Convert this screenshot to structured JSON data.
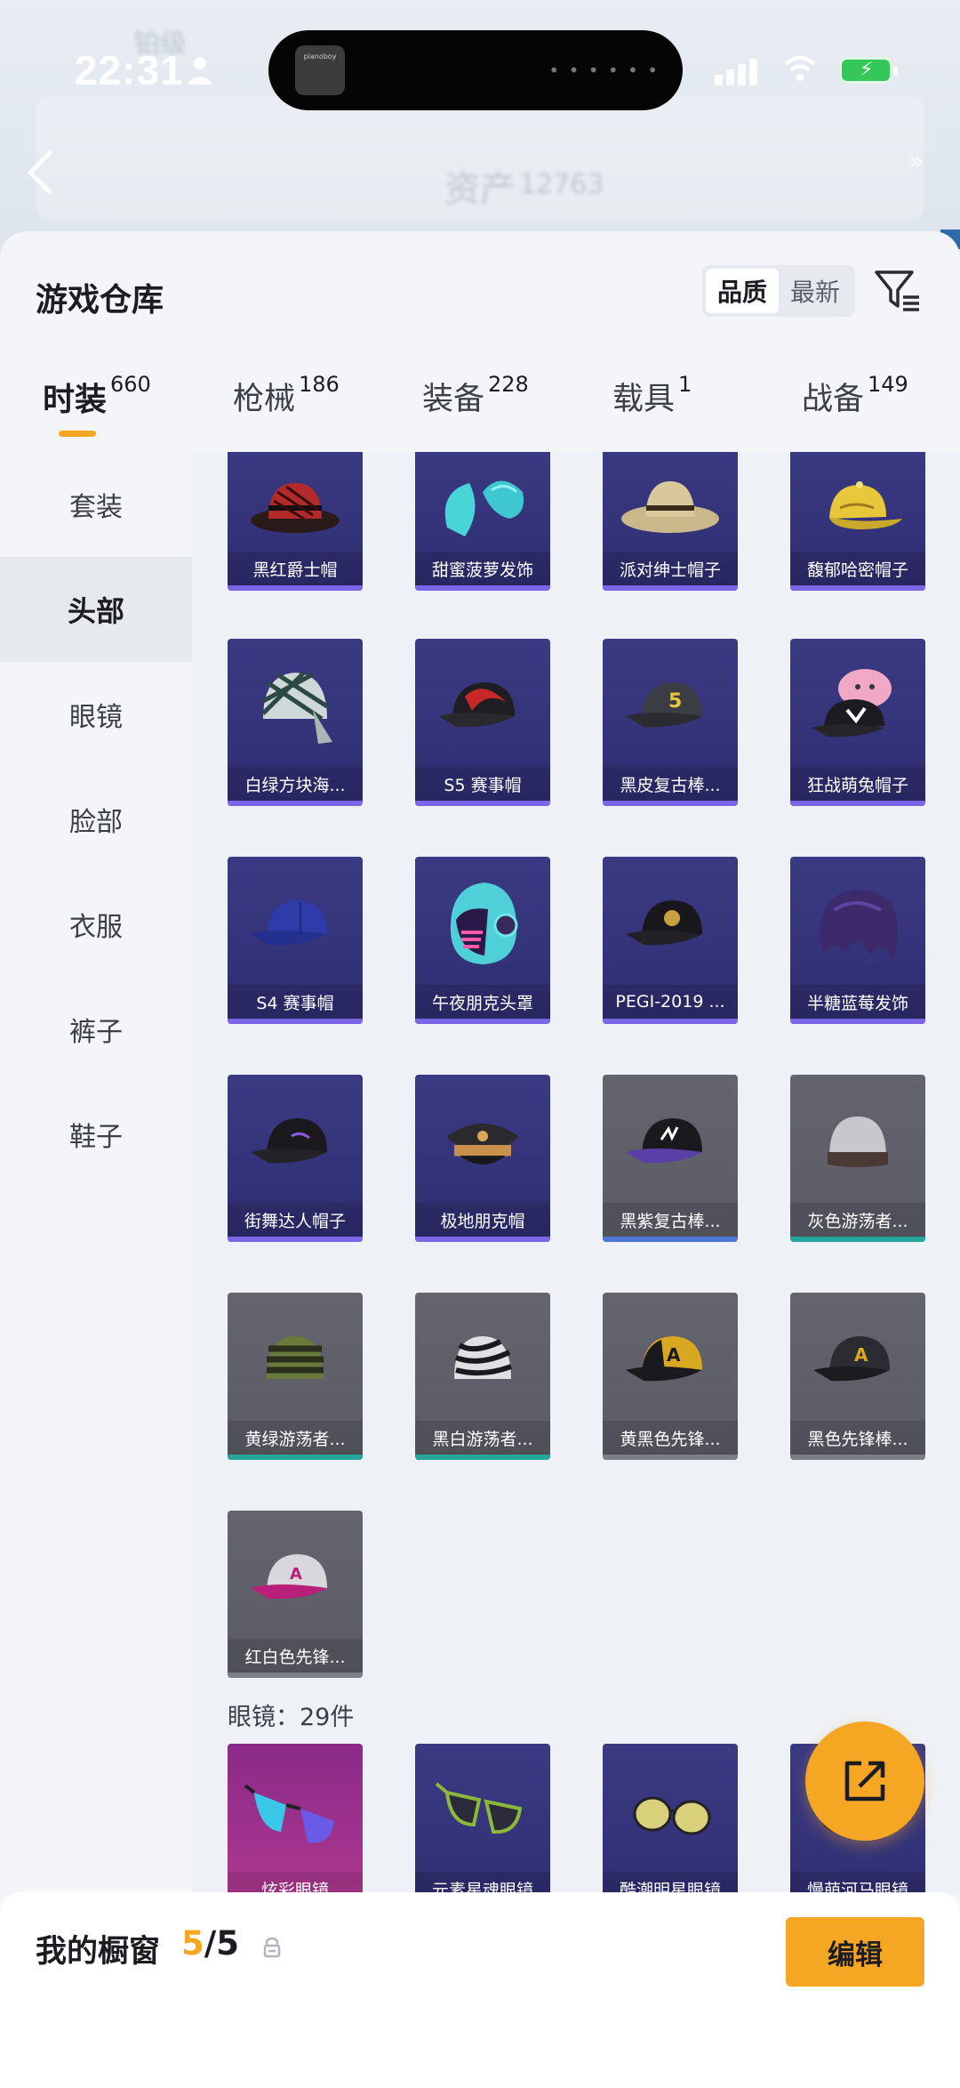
{
  "status_bar": {
    "time": "22:31",
    "island_app_text": "pianoboy"
  },
  "header_bg": {
    "title": "资产",
    "asset_count": "12763",
    "level": "铂级"
  },
  "sheet": {
    "title": "游戏仓库",
    "sort_options": [
      "品质",
      "最新"
    ],
    "sort_active": "品质"
  },
  "tabs": [
    {
      "label": "时装",
      "count": "660"
    },
    {
      "label": "枪械",
      "count": "186"
    },
    {
      "label": "装备",
      "count": "228"
    },
    {
      "label": "载具",
      "count": "1"
    },
    {
      "label": "战备",
      "count": "149"
    }
  ],
  "side_nav": [
    "套装",
    "头部",
    "眼镜",
    "脸部",
    "衣服",
    "裤子",
    "鞋子"
  ],
  "items": [
    {
      "name": "黑红爵士帽",
      "rarity": "purple",
      "icon": "fedora-red-black"
    },
    {
      "name": "甜蜜菠萝发饰",
      "rarity": "purple",
      "icon": "hair-cyan"
    },
    {
      "name": "派对绅士帽子",
      "rarity": "purple",
      "icon": "fedora-beige"
    },
    {
      "name": "馥郁哈密帽子",
      "rarity": "purple",
      "icon": "cap-yellow"
    },
    {
      "name": "白绿方块海...",
      "rarity": "purple",
      "icon": "bandana-checker"
    },
    {
      "name": "S5 赛事帽",
      "rarity": "purple",
      "icon": "cap-red-black"
    },
    {
      "name": "黑皮复古棒...",
      "rarity": "purple",
      "icon": "cap-dark-5"
    },
    {
      "name": "狂战萌兔帽子",
      "rarity": "purple",
      "icon": "cap-bunny"
    },
    {
      "name": "S4 赛事帽",
      "rarity": "purple",
      "icon": "cap-blue"
    },
    {
      "name": "午夜朋克头罩",
      "rarity": "purple",
      "icon": "helmet-neon"
    },
    {
      "name": "PEGI-2019 ...",
      "rarity": "purple",
      "icon": "cap-black-badge"
    },
    {
      "name": "半糖蓝莓发饰",
      "rarity": "purple",
      "icon": "hair-purple"
    },
    {
      "name": "街舞达人帽子",
      "rarity": "purple",
      "icon": "cap-black"
    },
    {
      "name": "极地朋克帽",
      "rarity": "purple",
      "icon": "officer-hat"
    },
    {
      "name": "黑紫复古棒...",
      "rarity": "gray-blue",
      "icon": "cap-black-purple"
    },
    {
      "name": "灰色游荡者...",
      "rarity": "gray-teal",
      "icon": "beanie-gray"
    },
    {
      "name": "黄绿游荡者...",
      "rarity": "gray-teal",
      "icon": "beanie-striped"
    },
    {
      "name": "黑白游荡者...",
      "rarity": "gray-teal",
      "icon": "beanie-zebra"
    },
    {
      "name": "黄黑色先锋...",
      "rarity": "gray",
      "icon": "cap-yellow-black"
    },
    {
      "name": "黑色先锋棒...",
      "rarity": "gray",
      "icon": "cap-black-a"
    },
    {
      "name": "红白色先锋...",
      "rarity": "gray",
      "icon": "cap-red-white"
    }
  ],
  "glasses_section": {
    "label": "眼镜：29件"
  },
  "glasses_items": [
    {
      "name": "炫彩眼镜",
      "rarity": "pink",
      "icon": "sunglasses-rainbow"
    },
    {
      "name": "元素星魂眼镜",
      "rarity": "purple",
      "icon": "sunglasses-green"
    },
    {
      "name": "酷潮明星眼镜",
      "rarity": "purple",
      "icon": "sunglasses-gold"
    },
    {
      "name": "慢萌河马眼镜",
      "rarity": "purple",
      "icon": "sunglasses-dark"
    }
  ],
  "showcase": {
    "title": "我的橱窗",
    "current": "5",
    "sep": "/",
    "total": "5",
    "edit_label": "编辑"
  },
  "colors": {
    "accent": "#f5a623",
    "purple_card": "#34337a",
    "gray_card": "#5a5b65",
    "pink_card": "#a1338e"
  }
}
